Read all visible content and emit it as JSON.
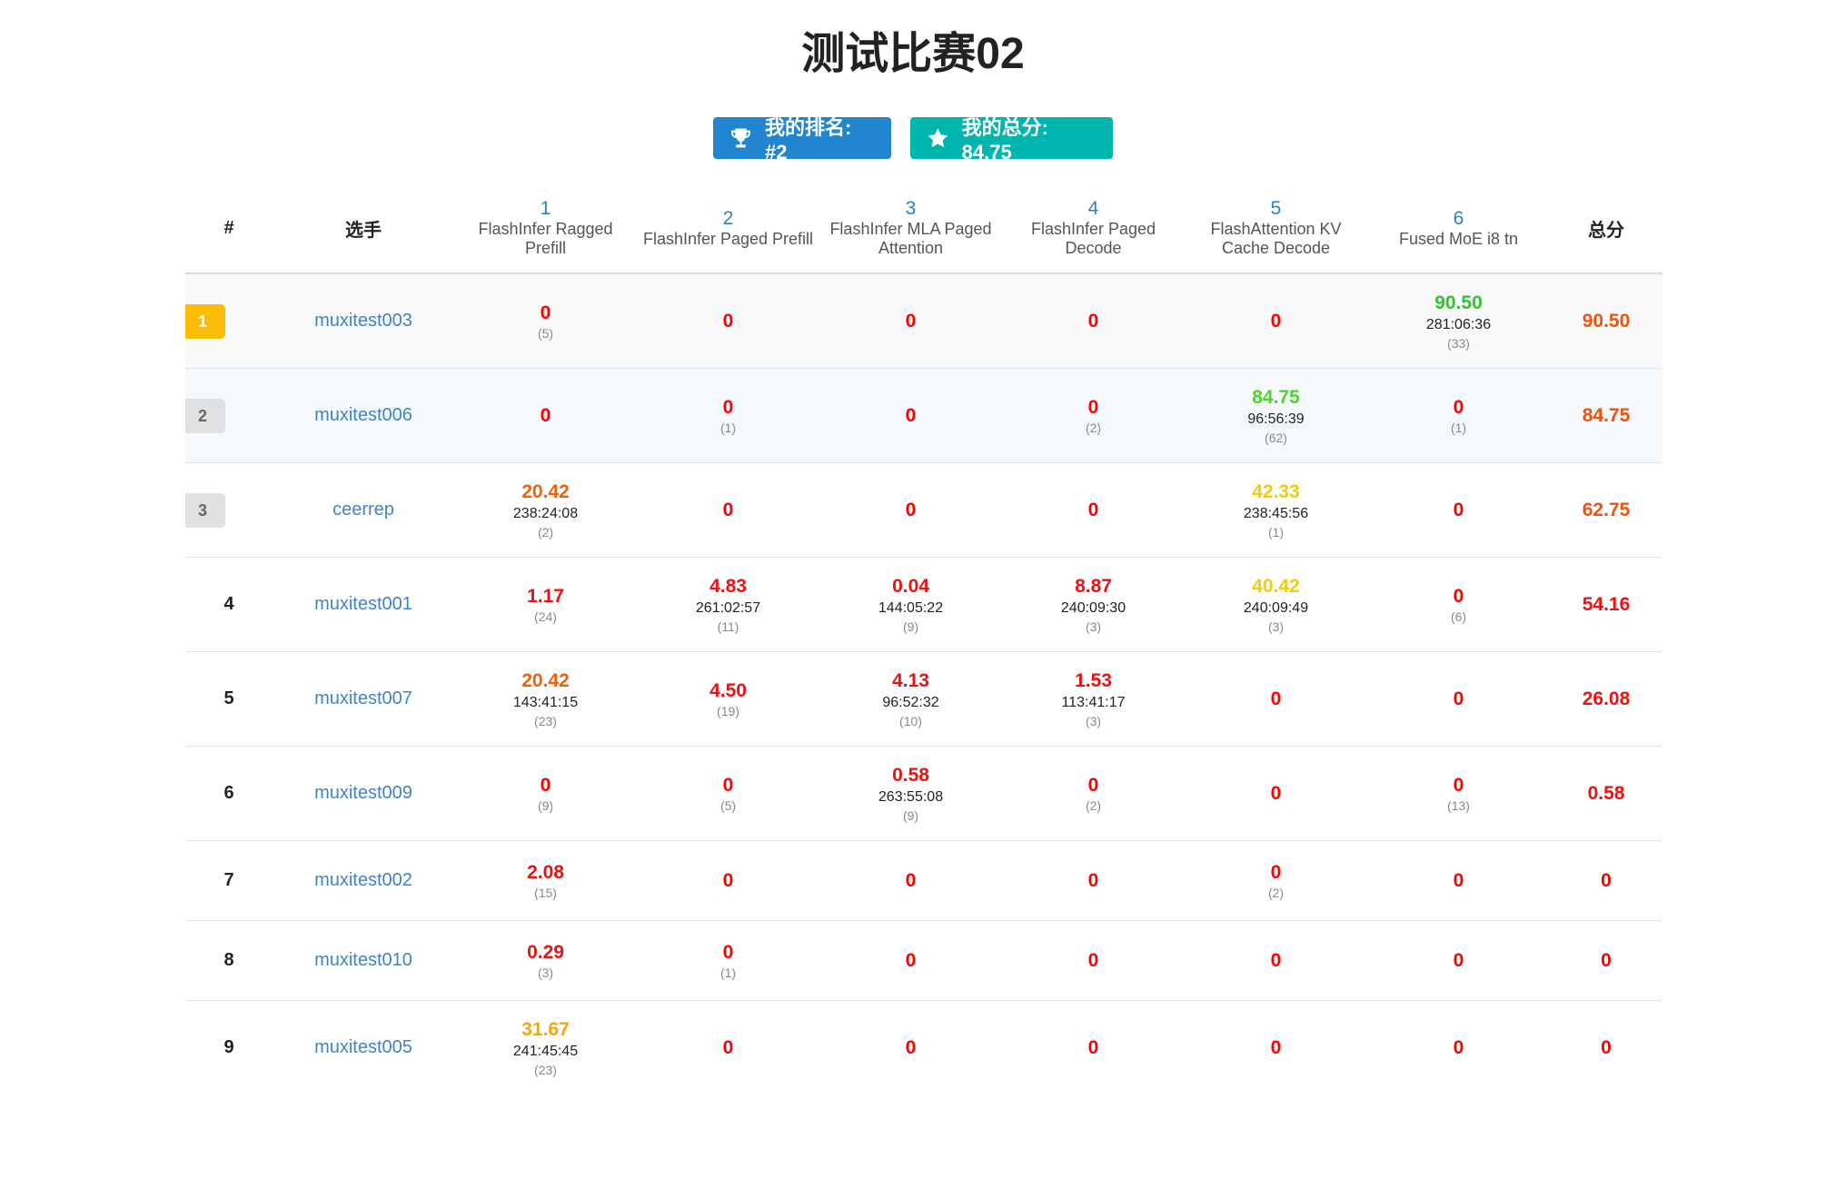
{
  "page_title": "测试比赛02",
  "badges": {
    "rank_label": "我的排名: #2",
    "score_label": "我的总分: 84.75"
  },
  "header": {
    "rank": "#",
    "player": "选手",
    "total": "总分",
    "problems": [
      {
        "num": "1",
        "name": "FlashInfer Ragged Prefill"
      },
      {
        "num": "2",
        "name": "FlashInfer Paged Prefill"
      },
      {
        "num": "3",
        "name": "FlashInfer MLA Paged Attention"
      },
      {
        "num": "4",
        "name": "FlashInfer Paged Decode"
      },
      {
        "num": "5",
        "name": "FlashAttention KV Cache Decode"
      },
      {
        "num": "6",
        "name": "Fused MoE i8 tn"
      }
    ]
  },
  "colors": {
    "zero": "#ff0000",
    "low": "#ee1111",
    "mid": "#f2600c",
    "amber": "#f7a600",
    "yellow": "#f3cc06",
    "green": "#2ec52e",
    "lime": "#4cd52c",
    "total_high": "#f2510c"
  },
  "rows": [
    {
      "rank": "1",
      "user": "muxitest003",
      "total": "90.50",
      "total_color": "#f2510c",
      "cells": [
        {
          "score": "0",
          "time": "",
          "tries": "(5)",
          "color": "#ff0000"
        },
        {
          "score": "0",
          "time": "",
          "tries": "",
          "color": "#ff0000"
        },
        {
          "score": "0",
          "time": "",
          "tries": "",
          "color": "#ff0000"
        },
        {
          "score": "0",
          "time": "",
          "tries": "",
          "color": "#ff0000"
        },
        {
          "score": "0",
          "time": "",
          "tries": "",
          "color": "#ff0000"
        },
        {
          "score": "90.50",
          "time": "281:06:36",
          "tries": "(33)",
          "color": "#2ec52e"
        }
      ]
    },
    {
      "rank": "2",
      "user": "muxitest006",
      "total": "84.75",
      "total_color": "#f2510c",
      "cells": [
        {
          "score": "0",
          "time": "",
          "tries": "",
          "color": "#ff0000"
        },
        {
          "score": "0",
          "time": "",
          "tries": "(1)",
          "color": "#ff0000"
        },
        {
          "score": "0",
          "time": "",
          "tries": "",
          "color": "#ff0000"
        },
        {
          "score": "0",
          "time": "",
          "tries": "(2)",
          "color": "#ff0000"
        },
        {
          "score": "84.75",
          "time": "96:56:39",
          "tries": "(62)",
          "color": "#4cd52c"
        },
        {
          "score": "0",
          "time": "",
          "tries": "(1)",
          "color": "#ff0000"
        }
      ]
    },
    {
      "rank": "3",
      "user": "ceerrep",
      "total": "62.75",
      "total_color": "#f2510c",
      "cells": [
        {
          "score": "20.42",
          "time": "238:24:08",
          "tries": "(2)",
          "color": "#f2600c"
        },
        {
          "score": "0",
          "time": "",
          "tries": "",
          "color": "#ff0000"
        },
        {
          "score": "0",
          "time": "",
          "tries": "",
          "color": "#ff0000"
        },
        {
          "score": "0",
          "time": "",
          "tries": "",
          "color": "#ff0000"
        },
        {
          "score": "42.33",
          "time": "238:45:56",
          "tries": "(1)",
          "color": "#f3cc06"
        },
        {
          "score": "0",
          "time": "",
          "tries": "",
          "color": "#ff0000"
        }
      ]
    },
    {
      "rank": "4",
      "user": "muxitest001",
      "total": "54.16",
      "total_color": "#ee1111",
      "cells": [
        {
          "score": "1.17",
          "time": "",
          "tries": "(24)",
          "color": "#ee1111"
        },
        {
          "score": "4.83",
          "time": "261:02:57",
          "tries": "(11)",
          "color": "#ee1111"
        },
        {
          "score": "0.04",
          "time": "144:05:22",
          "tries": "(9)",
          "color": "#ee1111"
        },
        {
          "score": "8.87",
          "time": "240:09:30",
          "tries": "(3)",
          "color": "#ee1111"
        },
        {
          "score": "40.42",
          "time": "240:09:49",
          "tries": "(3)",
          "color": "#f3cc06"
        },
        {
          "score": "0",
          "time": "",
          "tries": "(6)",
          "color": "#ff0000"
        }
      ]
    },
    {
      "rank": "5",
      "user": "muxitest007",
      "total": "26.08",
      "total_color": "#ee1111",
      "cells": [
        {
          "score": "20.42",
          "time": "143:41:15",
          "tries": "(23)",
          "color": "#f2600c"
        },
        {
          "score": "4.50",
          "time": "",
          "tries": "(19)",
          "color": "#ee1111"
        },
        {
          "score": "4.13",
          "time": "96:52:32",
          "tries": "(10)",
          "color": "#ee1111"
        },
        {
          "score": "1.53",
          "time": "113:41:17",
          "tries": "(3)",
          "color": "#ee1111"
        },
        {
          "score": "0",
          "time": "",
          "tries": "",
          "color": "#ff0000"
        },
        {
          "score": "0",
          "time": "",
          "tries": "",
          "color": "#ff0000"
        }
      ]
    },
    {
      "rank": "6",
      "user": "muxitest009",
      "total": "0.58",
      "total_color": "#ee1111",
      "cells": [
        {
          "score": "0",
          "time": "",
          "tries": "(9)",
          "color": "#ff0000"
        },
        {
          "score": "0",
          "time": "",
          "tries": "(5)",
          "color": "#ff0000"
        },
        {
          "score": "0.58",
          "time": "263:55:08",
          "tries": "(9)",
          "color": "#ee1111"
        },
        {
          "score": "0",
          "time": "",
          "tries": "(2)",
          "color": "#ff0000"
        },
        {
          "score": "0",
          "time": "",
          "tries": "",
          "color": "#ff0000"
        },
        {
          "score": "0",
          "time": "",
          "tries": "(13)",
          "color": "#ff0000"
        }
      ]
    },
    {
      "rank": "7",
      "user": "muxitest002",
      "total": "0",
      "total_color": "#ff0000",
      "cells": [
        {
          "score": "2.08",
          "time": "",
          "tries": "(15)",
          "color": "#ee1111"
        },
        {
          "score": "0",
          "time": "",
          "tries": "",
          "color": "#ff0000"
        },
        {
          "score": "0",
          "time": "",
          "tries": "",
          "color": "#ff0000"
        },
        {
          "score": "0",
          "time": "",
          "tries": "",
          "color": "#ff0000"
        },
        {
          "score": "0",
          "time": "",
          "tries": "(2)",
          "color": "#ff0000"
        },
        {
          "score": "0",
          "time": "",
          "tries": "",
          "color": "#ff0000"
        }
      ]
    },
    {
      "rank": "8",
      "user": "muxitest010",
      "total": "0",
      "total_color": "#ff0000",
      "cells": [
        {
          "score": "0.29",
          "time": "",
          "tries": "(3)",
          "color": "#ee1111"
        },
        {
          "score": "0",
          "time": "",
          "tries": "(1)",
          "color": "#ff0000"
        },
        {
          "score": "0",
          "time": "",
          "tries": "",
          "color": "#ff0000"
        },
        {
          "score": "0",
          "time": "",
          "tries": "",
          "color": "#ff0000"
        },
        {
          "score": "0",
          "time": "",
          "tries": "",
          "color": "#ff0000"
        },
        {
          "score": "0",
          "time": "",
          "tries": "",
          "color": "#ff0000"
        }
      ]
    },
    {
      "rank": "9",
      "user": "muxitest005",
      "total": "0",
      "total_color": "#ff0000",
      "cells": [
        {
          "score": "31.67",
          "time": "241:45:45",
          "tries": "(23)",
          "color": "#f7a600"
        },
        {
          "score": "0",
          "time": "",
          "tries": "",
          "color": "#ff0000"
        },
        {
          "score": "0",
          "time": "",
          "tries": "",
          "color": "#ff0000"
        },
        {
          "score": "0",
          "time": "",
          "tries": "",
          "color": "#ff0000"
        },
        {
          "score": "0",
          "time": "",
          "tries": "",
          "color": "#ff0000"
        },
        {
          "score": "0",
          "time": "",
          "tries": "",
          "color": "#ff0000"
        }
      ]
    }
  ]
}
